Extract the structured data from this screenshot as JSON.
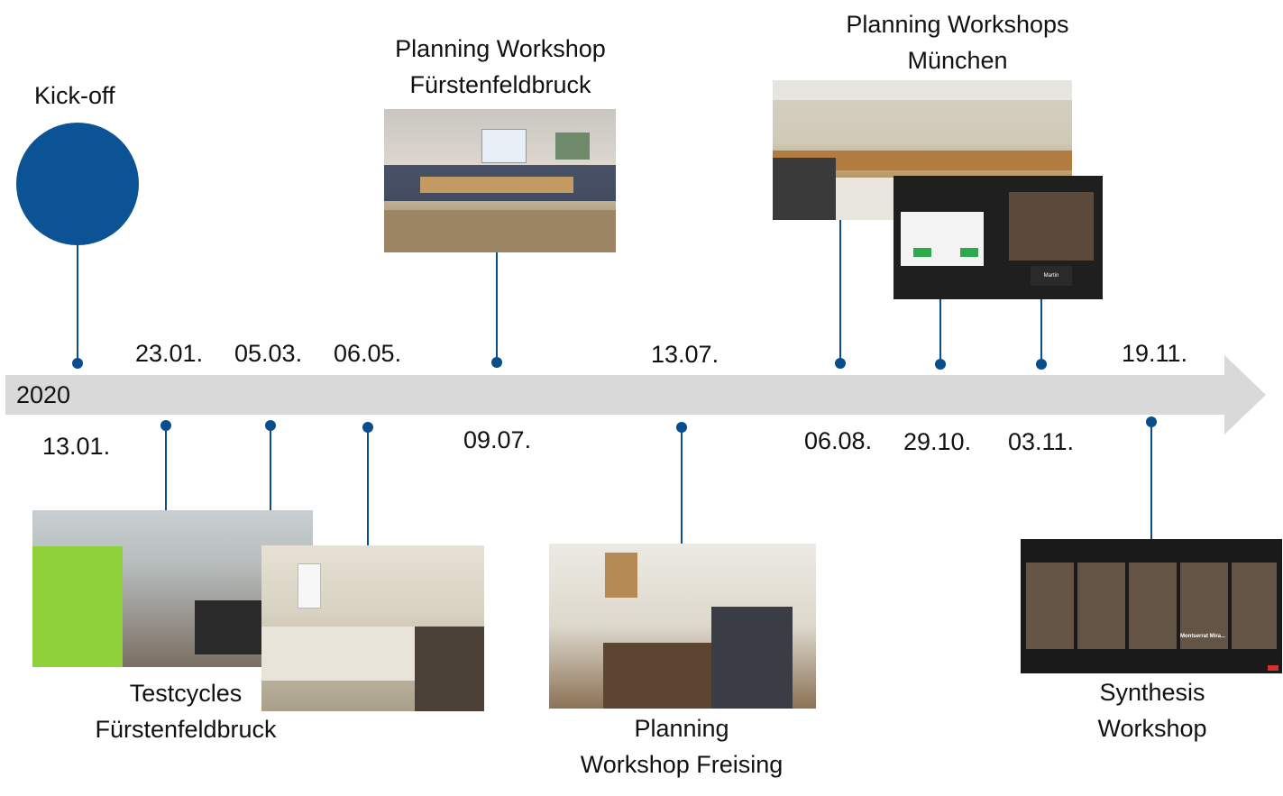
{
  "timeline": {
    "year": "2020",
    "colors": {
      "arrow": "#d9d9d9",
      "marker": "#0a4d8c",
      "kickoff": "#0b5394"
    }
  },
  "dates": {
    "d1": "13.01.",
    "d2": "23.01.",
    "d3": "05.03.",
    "d4": "06.05.",
    "d5": "09.07.",
    "d6": "13.07.",
    "d7": "06.08.",
    "d8": "29.10.",
    "d9": "03.11.",
    "d10": "19.11."
  },
  "events": {
    "kickoff": "Kick-off",
    "ffb_planning": [
      "Planning Workshop",
      "Fürstenfeldbruck"
    ],
    "muenchen": [
      "Planning Workshops",
      "München"
    ],
    "testcycles": [
      "Testcycles",
      "Fürstenfeldbruck"
    ],
    "freising": [
      "Planning",
      "Workshop Freising"
    ],
    "synthesis": [
      "Synthesis",
      "Workshop"
    ]
  },
  "photos": {
    "zoom_muenchen_name": "Martin",
    "zoom_synthesis_name": "Montserrat Mira..."
  }
}
